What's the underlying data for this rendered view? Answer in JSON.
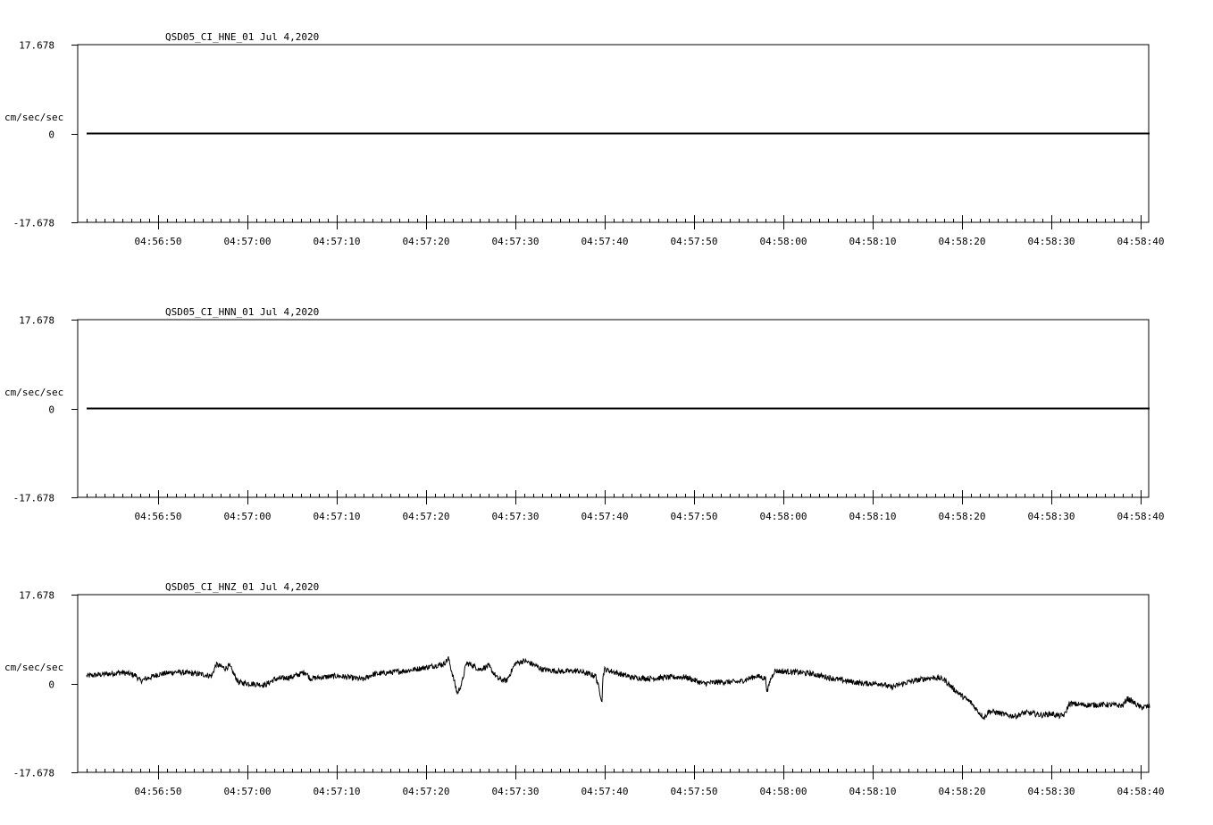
{
  "colors": {
    "background": "#ffffff",
    "ink": "#000000"
  },
  "chart_data": [
    {
      "type": "line",
      "title": "QSD05_CI_HNE_01  Jul 4,2020",
      "ylabel": "cm/sec/sec",
      "ylim": [
        -17.678,
        17.678
      ],
      "y_tick_labels": [
        "17.678",
        "0",
        "-17.678"
      ],
      "x_tick_labels": [
        "04:56:50",
        "04:57:00",
        "04:57:10",
        "04:57:20",
        "04:57:30",
        "04:57:40",
        "04:57:50",
        "04:58:00",
        "04:58:10",
        "04:58:20",
        "04:58:30",
        "04:58:40"
      ],
      "x_start": "04:56:42",
      "x_end": "04:58:41",
      "grid": false,
      "series": [
        {
          "x": [
            "04:56:42",
            "04:58:41"
          ],
          "y": [
            0,
            0
          ]
        }
      ]
    },
    {
      "type": "line",
      "title": "QSD05_CI_HNN_01  Jul 4,2020",
      "ylabel": "cm/sec/sec",
      "ylim": [
        -17.678,
        17.678
      ],
      "y_tick_labels": [
        "17.678",
        "0",
        "-17.678"
      ],
      "x_tick_labels": [
        "04:56:50",
        "04:57:00",
        "04:57:10",
        "04:57:20",
        "04:57:30",
        "04:57:40",
        "04:57:50",
        "04:58:00",
        "04:58:10",
        "04:58:20",
        "04:58:30",
        "04:58:40"
      ],
      "x_start": "04:56:42",
      "x_end": "04:58:41",
      "grid": false,
      "series": [
        {
          "x": [
            "04:56:42",
            "04:58:41"
          ],
          "y": [
            0,
            0
          ]
        }
      ]
    },
    {
      "type": "line",
      "title": "QSD05_CI_HNZ_01  Jul 4,2020",
      "ylabel": "cm/sec/sec",
      "ylim": [
        -17.678,
        17.678
      ],
      "y_tick_labels": [
        "17.678",
        "0",
        "-17.678"
      ],
      "x_tick_labels": [
        "04:56:50",
        "04:57:00",
        "04:57:10",
        "04:57:20",
        "04:57:30",
        "04:57:40",
        "04:57:50",
        "04:58:00",
        "04:58:10",
        "04:58:20",
        "04:58:30",
        "04:58:40"
      ],
      "x_start": "04:56:42",
      "x_end": "04:58:41",
      "grid": false,
      "series": [
        {
          "x": [
            "04:56:42",
            "04:56:46",
            "04:56:47.5",
            "04:56:48",
            "04:56:50",
            "04:56:52",
            "04:56:55",
            "04:56:56",
            "04:56:56.5",
            "04:56:57.5",
            "04:56:58",
            "04:56:59",
            "04:57:02",
            "04:57:03",
            "04:57:05",
            "04:57:06.5",
            "04:57:07",
            "04:57:10",
            "04:57:11",
            "04:57:13",
            "04:57:14",
            "04:57:16",
            "04:57:18",
            "04:57:20",
            "04:57:22",
            "04:57:22.5",
            "04:57:23",
            "04:57:23.5",
            "04:57:24",
            "04:57:24.5",
            "04:57:25",
            "04:57:26",
            "04:57:27",
            "04:57:28",
            "04:57:29",
            "04:57:30",
            "04:57:31",
            "04:57:32",
            "04:57:33",
            "04:57:35",
            "04:57:37",
            "04:57:39",
            "04:57:39.7",
            "04:57:39.8",
            "04:57:40",
            "04:57:41",
            "04:57:43",
            "04:57:45",
            "04:57:47",
            "04:57:49",
            "04:57:51",
            "04:57:53",
            "04:57:55",
            "04:57:57",
            "04:57:58",
            "04:57:58.2",
            "04:57:58.5",
            "04:57:59",
            "04:58:01",
            "04:58:03",
            "04:58:05",
            "04:58:07",
            "04:58:09",
            "04:58:11",
            "04:58:12",
            "04:58:14",
            "04:58:16",
            "04:58:17",
            "04:58:18",
            "04:58:19",
            "04:58:20",
            "04:58:21",
            "04:58:22",
            "04:58:22.5",
            "04:58:23",
            "04:58:24",
            "04:58:25",
            "04:58:26",
            "04:58:27",
            "04:58:28",
            "04:58:29",
            "04:58:30",
            "04:58:31",
            "04:58:31.5",
            "04:58:32",
            "04:58:34",
            "04:58:36",
            "04:58:38",
            "04:58:38.5",
            "04:58:39",
            "04:58:40",
            "04:58:41"
          ],
          "y": [
            1.5,
            2.2,
            1.6,
            0.5,
            1.8,
            2.3,
            1.8,
            1.5,
            3.8,
            3.0,
            3.5,
            0.2,
            -0.3,
            0.8,
            1.3,
            2.3,
            1.0,
            1.5,
            1.3,
            0.8,
            1.8,
            2.2,
            2.6,
            3.2,
            3.9,
            5.0,
            1.5,
            -2.0,
            0.0,
            4.0,
            3.8,
            2.8,
            3.5,
            1.0,
            0.5,
            4.0,
            4.5,
            3.8,
            2.8,
            2.4,
            2.5,
            1.5,
            -3.5,
            1.5,
            2.8,
            2.3,
            1.2,
            1.0,
            1.2,
            1.3,
            0.0,
            0.3,
            0.3,
            1.5,
            1.0,
            -1.8,
            0.5,
            2.5,
            2.3,
            2.0,
            1.2,
            0.5,
            0.0,
            0.0,
            -0.8,
            0.3,
            1.0,
            1.2,
            0.8,
            -1.0,
            -2.5,
            -3.8,
            -6.0,
            -6.8,
            -5.5,
            -5.8,
            -6.3,
            -6.5,
            -5.8,
            -6.0,
            -6.3,
            -6.0,
            -6.5,
            -6.2,
            -4.0,
            -4.3,
            -4.2,
            -4.4,
            -3.0,
            -3.5,
            -4.8,
            -4.5
          ]
        }
      ]
    }
  ]
}
